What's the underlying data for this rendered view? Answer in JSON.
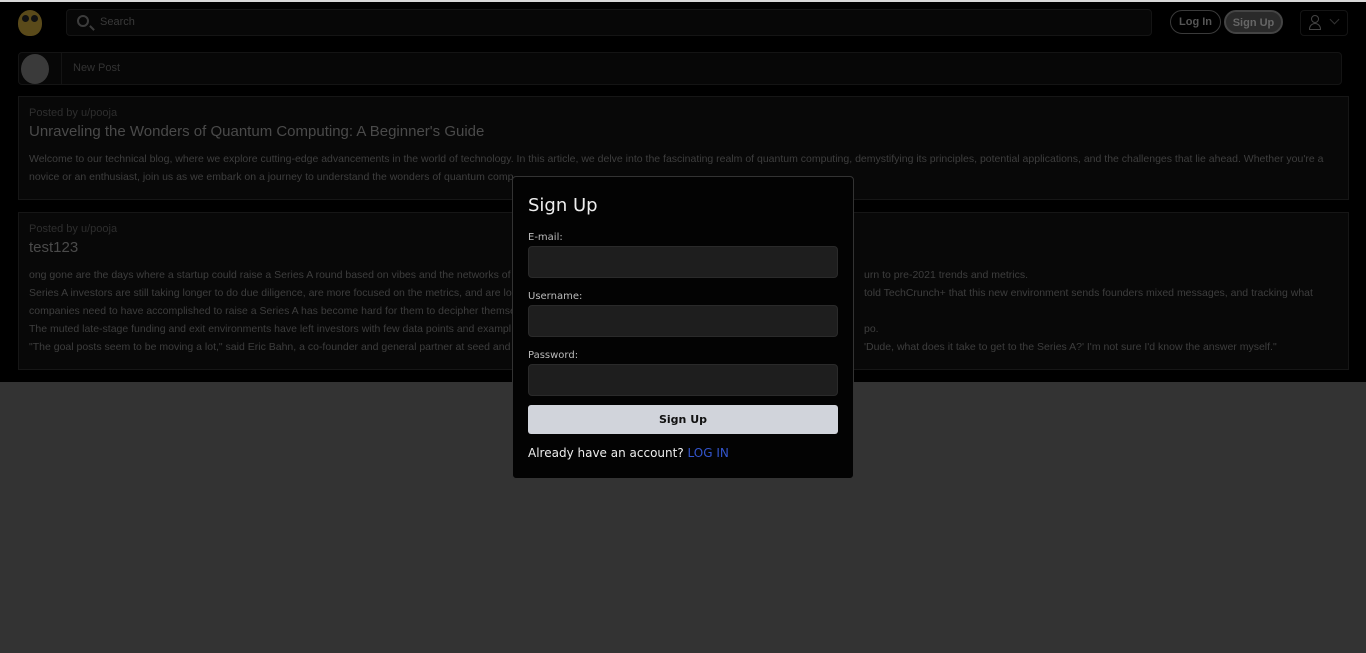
{
  "header": {
    "search_placeholder": "Search",
    "login_label": "Log In",
    "signup_label": "Sign Up"
  },
  "new_post": {
    "placeholder": "New Post"
  },
  "posts": [
    {
      "author": "Posted by u/pooja",
      "title": "Unraveling the Wonders of Quantum Computing: A Beginner's Guide",
      "lines": [
        {
          "left": "Welcome to our technical blog, where we explore cutting-edge advancements in the world of technology. In this article, we delve into the fascinating realm of quantum computing, demystifying its principles, potential applications, and the challenges that lie ahead. Whether you're a",
          "right": ""
        },
        {
          "left": "novice or an enthusiast, join us as we embark on a journey to understand the wonders of quantum comp",
          "right": ""
        }
      ]
    },
    {
      "author": "Posted by u/pooja",
      "title": "test123",
      "lines": [
        {
          "left": "ong gone are the days where a startup could raise a Series A round based on vibes and the networks of i",
          "right": "urn to pre-2021 trends and metrics."
        },
        {
          "left": "Series A investors are still taking longer to do due diligence, are more focused on the metrics, and are loo",
          "right": "told TechCrunch+ that this new environment sends founders mixed messages, and tracking what"
        },
        {
          "left": "companies need to have accomplished to raise a Series A has become hard for them to decipher themse",
          "right": ""
        },
        {
          "left": "The muted late-stage funding and exit environments have left investors with few data points and exampl",
          "right": "po."
        },
        {
          "left": "\"The goal posts seem to be moving a lot,\" said Eric Bahn, a co-founder and general partner at seed and p",
          "right": "'Dude, what does it take to get to the Series A?' I'm not sure I'd know the answer myself.\""
        }
      ]
    }
  ],
  "modal": {
    "title": "Sign Up",
    "email_label": "E-mail:",
    "username_label": "Username:",
    "password_label": "Password:",
    "submit_label": "Sign Up",
    "footer_text": "Already have an account?",
    "login_link": "LOG IN"
  },
  "colors": {
    "link": "#3355cc",
    "submit_bg": "#d1d4db"
  }
}
